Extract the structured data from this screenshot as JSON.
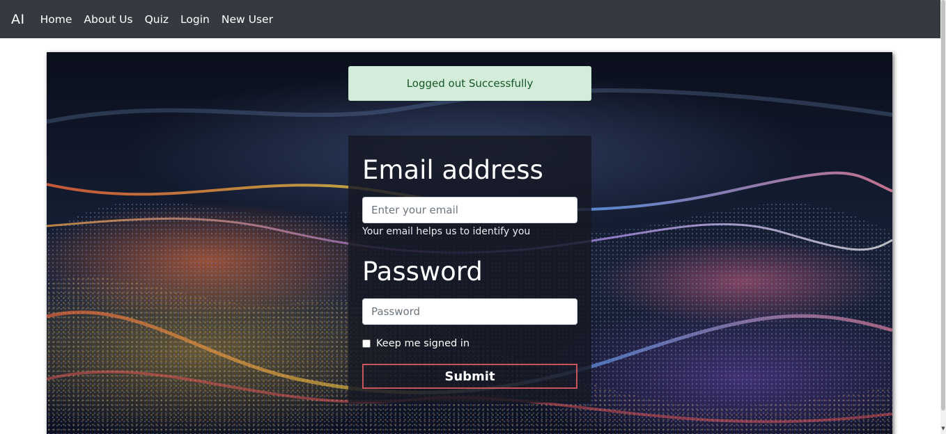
{
  "nav": {
    "brand": "AI",
    "links": [
      "Home",
      "About Us",
      "Quiz",
      "Login",
      "New User"
    ]
  },
  "alert": {
    "message": "Logged out Successfully",
    "color": "#d4edda"
  },
  "form": {
    "email_heading": "Email address",
    "email_placeholder": "Enter your email",
    "email_value": "",
    "email_help": "Your email helps us to identify you",
    "password_heading": "Password",
    "password_placeholder": "Password",
    "password_value": "",
    "remember_label": "Keep me signed in",
    "remember_checked": false,
    "submit_label": "Submit",
    "submit_border_color": "#c9555c"
  },
  "colors": {
    "navbar": "#343a40",
    "alert_text": "#155724"
  }
}
